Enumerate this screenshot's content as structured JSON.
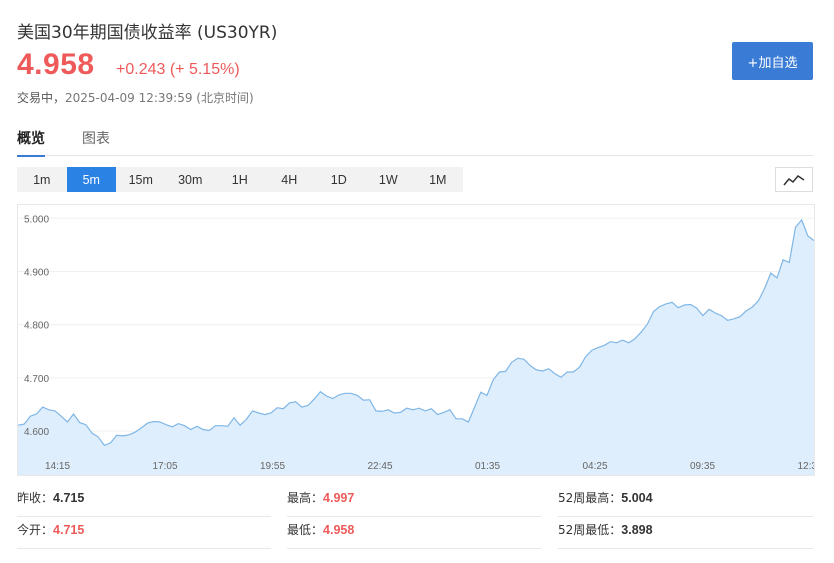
{
  "header": {
    "title": "美国30年期国债收益率 (US30YR)",
    "price": "4.958",
    "change": "+0.243 (+ 5.15%)",
    "status": "交易中，",
    "timestamp": "2025-04-09 12:39:59 (北京时间)",
    "add_button": "+加自选"
  },
  "tabs": [
    {
      "label": "概览",
      "active": true
    },
    {
      "label": "图表",
      "active": false
    }
  ],
  "periods": [
    {
      "label": "1m",
      "active": false
    },
    {
      "label": "5m",
      "active": true
    },
    {
      "label": "15m",
      "active": false
    },
    {
      "label": "30m",
      "active": false
    },
    {
      "label": "1H",
      "active": false
    },
    {
      "label": "4H",
      "active": false
    },
    {
      "label": "1D",
      "active": false
    },
    {
      "label": "1W",
      "active": false
    },
    {
      "label": "1M",
      "active": false
    }
  ],
  "colors": {
    "accent": "#2a82e4",
    "up": "#ee5a5a",
    "line": "#7fb6e6",
    "area": "#dfeefc"
  },
  "chart_data": {
    "type": "area",
    "y_ticks": [
      "5.000",
      "4.900",
      "4.800",
      "4.700",
      "4.600"
    ],
    "ylim": [
      4.555,
      5.025
    ],
    "x_ticks": [
      "14:15",
      "17:05",
      "19:55",
      "22:45",
      "01:35",
      "04:25",
      "09:35",
      "12:3"
    ],
    "values": [
      4.611,
      4.613,
      4.628,
      4.632,
      4.645,
      4.64,
      4.638,
      4.628,
      4.617,
      4.632,
      4.616,
      4.612,
      4.596,
      4.589,
      4.573,
      4.578,
      4.592,
      4.591,
      4.593,
      4.598,
      4.606,
      4.615,
      4.618,
      4.617,
      4.612,
      4.608,
      4.614,
      4.61,
      4.603,
      4.609,
      4.603,
      4.601,
      4.61,
      4.61,
      4.609,
      4.625,
      4.611,
      4.622,
      4.638,
      4.634,
      4.631,
      4.634,
      4.644,
      4.642,
      4.653,
      4.655,
      4.645,
      4.648,
      4.66,
      4.674,
      4.666,
      4.661,
      4.668,
      4.671,
      4.671,
      4.667,
      4.658,
      4.659,
      4.638,
      4.637,
      4.64,
      4.634,
      4.635,
      4.643,
      4.64,
      4.643,
      4.638,
      4.642,
      4.631,
      4.635,
      4.64,
      4.623,
      4.623,
      4.617,
      4.645,
      4.673,
      4.667,
      4.696,
      4.711,
      4.712,
      4.729,
      4.737,
      4.735,
      4.723,
      4.715,
      4.713,
      4.717,
      4.708,
      4.701,
      4.711,
      4.711,
      4.72,
      4.74,
      4.752,
      4.757,
      4.761,
      4.768,
      4.766,
      4.771,
      4.766,
      4.774,
      4.786,
      4.801,
      4.825,
      4.834,
      4.839,
      4.842,
      4.832,
      4.837,
      4.838,
      4.831,
      4.817,
      4.829,
      4.822,
      4.817,
      4.808,
      4.811,
      4.815,
      4.826,
      4.833,
      4.845,
      4.868,
      4.897,
      4.888,
      4.922,
      4.917,
      4.983,
      4.997,
      4.967,
      4.958
    ]
  },
  "stats": [
    {
      "label": "昨收：",
      "value": "4.715",
      "red": false
    },
    {
      "label": "最高：",
      "value": "4.997",
      "red": true
    },
    {
      "label": "52周最高：",
      "value": "5.004",
      "red": false
    },
    {
      "label": "今开：",
      "value": "4.715",
      "red": true
    },
    {
      "label": "最低：",
      "value": "4.958",
      "red": true
    },
    {
      "label": "52周最低：",
      "value": "3.898",
      "red": false
    }
  ]
}
